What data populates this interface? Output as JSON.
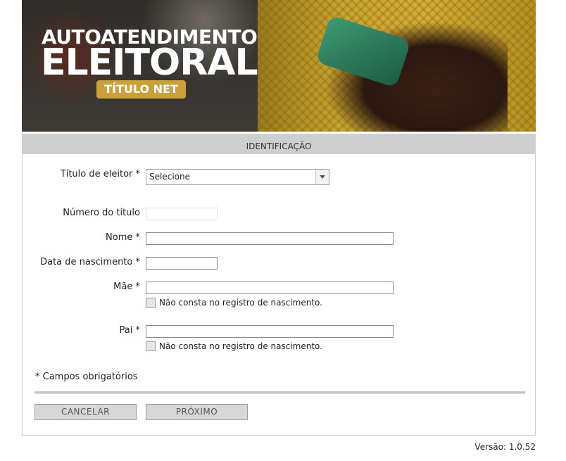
{
  "banner": {
    "title_line1": "AUTOATENDIMENTO",
    "title_line2": "ELEITORAL",
    "badge": "TÍTULO NET"
  },
  "form": {
    "section_title": "IDENTIFICAÇÃO",
    "titulo_label": "Título de eleitor *",
    "titulo_selected": "Selecione",
    "numero_label": "Número do título",
    "numero_value": "",
    "nome_label": "Nome *",
    "nome_value": "",
    "nascimento_label": "Data de nascimento *",
    "nascimento_value": "",
    "mae_label": "Mãe *",
    "mae_value": "",
    "mae_checkbox_label": "Não consta no registro de nascimento.",
    "mae_checked": false,
    "pai_label": "Pai *",
    "pai_value": "",
    "pai_checkbox_label": "Não consta no registro de nascimento.",
    "pai_checked": false,
    "required_note": "* Campos obrigatórios"
  },
  "actions": {
    "cancel_label": "CANCELAR",
    "next_label": "PRÓXIMO"
  },
  "footer": {
    "version": "Versão: 1.0.52"
  }
}
